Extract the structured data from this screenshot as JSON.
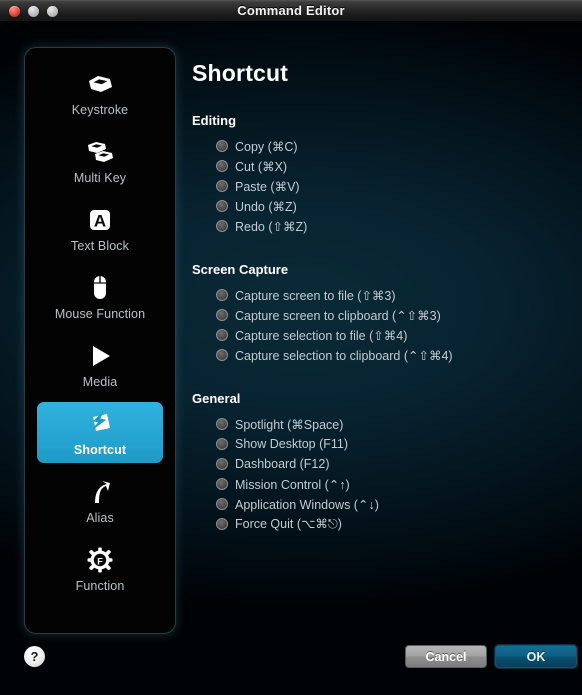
{
  "window": {
    "title": "Command Editor",
    "traffic_lights": [
      "close",
      "minimize",
      "maximize"
    ]
  },
  "sidebar": {
    "items": [
      {
        "label": "Keystroke",
        "icon": "keycap-icon",
        "selected": false
      },
      {
        "label": "Multi Key",
        "icon": "multi-keycap-icon",
        "selected": false
      },
      {
        "label": "Text Block",
        "icon": "letter-a-block-icon",
        "selected": false
      },
      {
        "label": "Mouse Function",
        "icon": "mouse-icon",
        "selected": false
      },
      {
        "label": "Media",
        "icon": "play-triangle-icon",
        "selected": false
      },
      {
        "label": "Shortcut",
        "icon": "lightning-bolt-icon",
        "selected": true
      },
      {
        "label": "Alias",
        "icon": "curved-arrow-icon",
        "selected": false
      },
      {
        "label": "Function",
        "icon": "gear-f-icon",
        "selected": false
      }
    ],
    "selected_color": "#29ABD6"
  },
  "main": {
    "title": "Shortcut",
    "groups": [
      {
        "title": "Editing",
        "options": [
          {
            "label": "Copy (⌘C)",
            "selected": false
          },
          {
            "label": "Cut (⌘X)",
            "selected": false
          },
          {
            "label": "Paste (⌘V)",
            "selected": false
          },
          {
            "label": "Undo (⌘Z)",
            "selected": false
          },
          {
            "label": "Redo (⇧⌘Z)",
            "selected": false
          }
        ]
      },
      {
        "title": "Screen Capture",
        "options": [
          {
            "label": "Capture screen to file  (⇧⌘3)",
            "selected": false
          },
          {
            "label": "Capture screen to clipboard  (⌃⇧⌘3)",
            "selected": false
          },
          {
            "label": "Capture selection to file  (⇧⌘4)",
            "selected": false
          },
          {
            "label": "Capture selection to clipboard  (⌃⇧⌘4)",
            "selected": false
          }
        ]
      },
      {
        "title": "General",
        "options": [
          {
            "label": "Spotlight (⌘Space)",
            "selected": false
          },
          {
            "label": "Show Desktop  (F11)",
            "selected": false
          },
          {
            "label": "Dashboard (F12)",
            "selected": false
          },
          {
            "label": "Mission Control  (⌃↑)",
            "selected": false
          },
          {
            "label": "Application Windows (⌃↓)",
            "selected": false
          },
          {
            "label": "Force Quit (⌥⌘⎋)",
            "selected": false
          }
        ]
      }
    ]
  },
  "footer": {
    "help_label": "?",
    "cancel_label": "Cancel",
    "ok_label": "OK"
  }
}
